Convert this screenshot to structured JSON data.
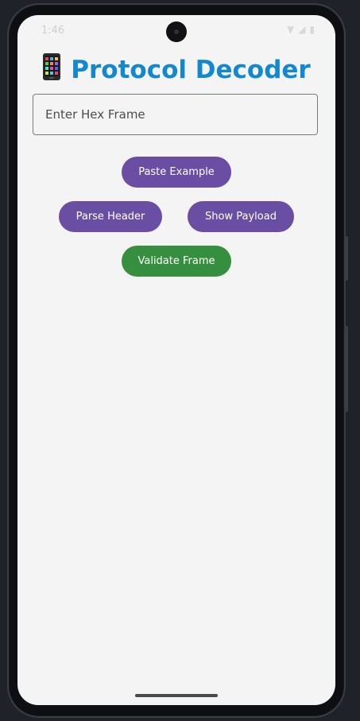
{
  "status_bar": {
    "time": "1:46",
    "icons": [
      "wifi-icon",
      "signal-icon",
      "battery-icon"
    ]
  },
  "app": {
    "title": "Protocol Decoder",
    "title_icon": "mobile-phone-emoji",
    "title_color": "#1388cf"
  },
  "input": {
    "placeholder": "Enter Hex Frame",
    "value": ""
  },
  "buttons": {
    "paste_example": "Paste Example",
    "parse_header": "Parse Header",
    "show_payload": "Show Payload",
    "validate_frame": "Validate Frame"
  },
  "colors": {
    "primary_button": "#6a4ea3",
    "validate_button": "#358f3e",
    "background": "#f4f4f4"
  }
}
